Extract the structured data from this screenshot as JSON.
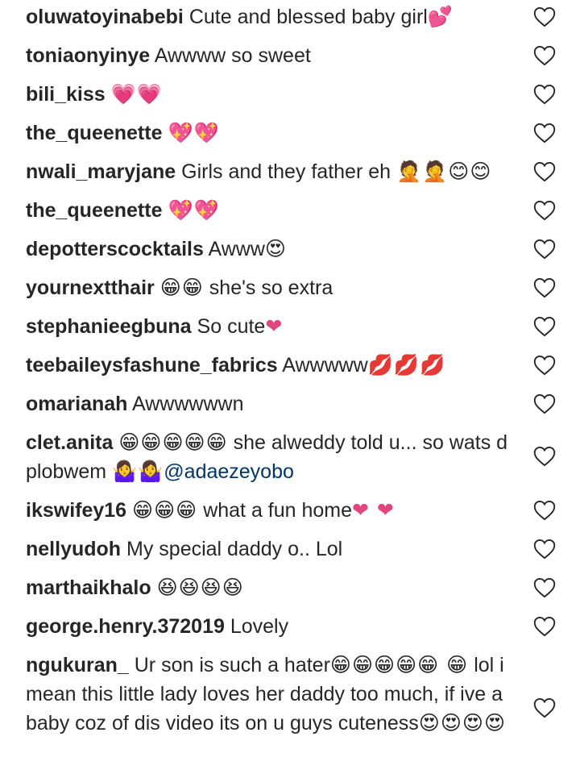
{
  "comments": [
    {
      "user": "oluwatoyinabebi",
      "text": "Cute and blessed baby girl",
      "emoji": "💕"
    },
    {
      "user": "toniaonyinye",
      "text": "Awwww so sweet",
      "emoji": ""
    },
    {
      "user": "bili_kiss",
      "text": "",
      "emoji": "💗💗"
    },
    {
      "user": "the_queenette",
      "text": "",
      "emoji": "💖💖"
    },
    {
      "user": "nwali_maryjane",
      "text": "Girls and they father eh",
      "emoji": "🤦🤦😊😊"
    },
    {
      "user": "the_queenette",
      "text": "",
      "emoji": "💖💖"
    },
    {
      "user": "depotterscocktails",
      "text": "Awww",
      "emoji": "😍"
    },
    {
      "user": "yournextthair",
      "pre_emoji": "😁😁",
      "text": "she's so extra",
      "emoji": ""
    },
    {
      "user": "stephanieegbuna",
      "text": "So cute",
      "emoji": "❤"
    },
    {
      "user": "teebaileysfashune_fabrics",
      "text": "Awwwww",
      "emoji": "💋💋💋"
    },
    {
      "user": "omarianah",
      "text": "Awwwwwwn",
      "emoji": ""
    },
    {
      "user": "clet.anita",
      "pre_emoji": "😁😁😁😁😁",
      "text": "she alweddy told u... so wats d plobwem",
      "emoji": "🤷‍♀🤷‍♀",
      "mention": "@adaezeyobo"
    },
    {
      "user": "ikswifey16",
      "pre_emoji": "😁😁😁",
      "text": "what a fun home",
      "emoji": "❤ ❤"
    },
    {
      "user": "nellyudoh",
      "text": "My special daddy o.. Lol",
      "emoji": ""
    },
    {
      "user": "marthaikhalo",
      "pre_emoji": "😆😆😆😆",
      "text": "",
      "emoji": ""
    },
    {
      "user": "george.henry.372019",
      "text": "Lovely",
      "emoji": ""
    },
    {
      "user": "ngukuran_",
      "text": "Ur son is such a hater",
      "emoji": "😁😁😁😁😁 😁",
      "text2": "lol i mean this little lady loves her daddy too much, if ive a baby coz of dis video its on u guys cuteness",
      "emoji2": "😍😍😍😍"
    }
  ]
}
